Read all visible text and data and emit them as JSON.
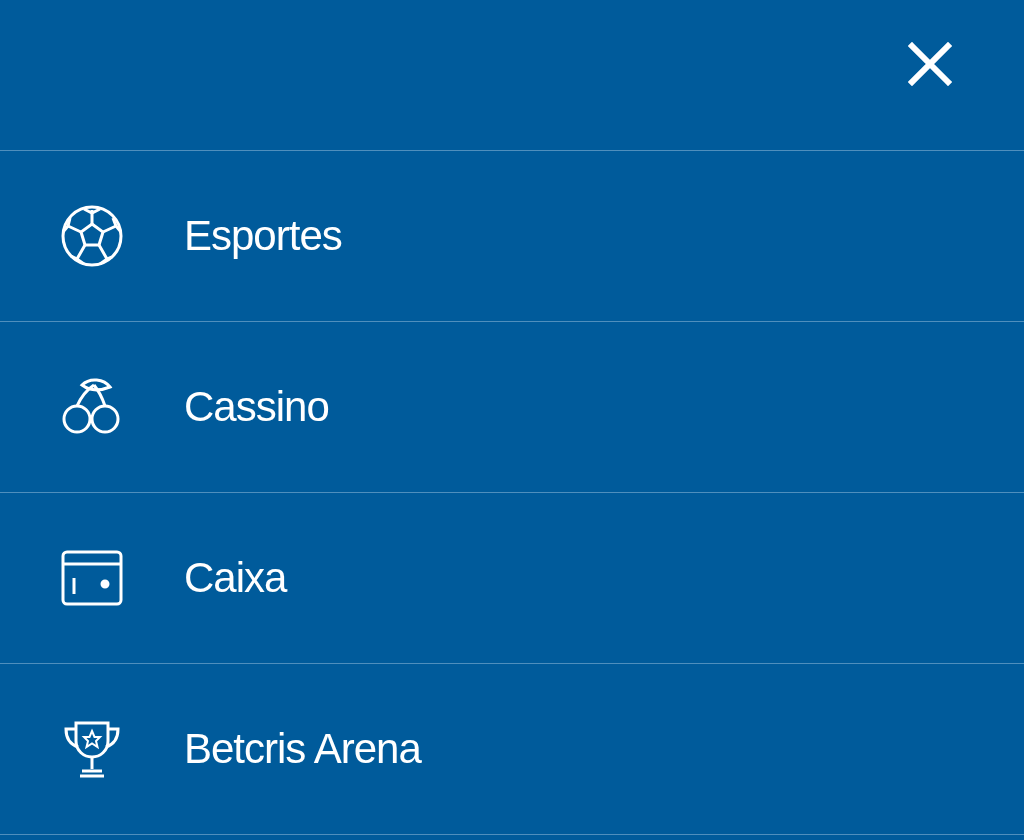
{
  "menu": {
    "items": [
      {
        "label": "Esportes"
      },
      {
        "label": "Cassino"
      },
      {
        "label": "Caixa"
      },
      {
        "label": "Betcris Arena"
      }
    ]
  }
}
